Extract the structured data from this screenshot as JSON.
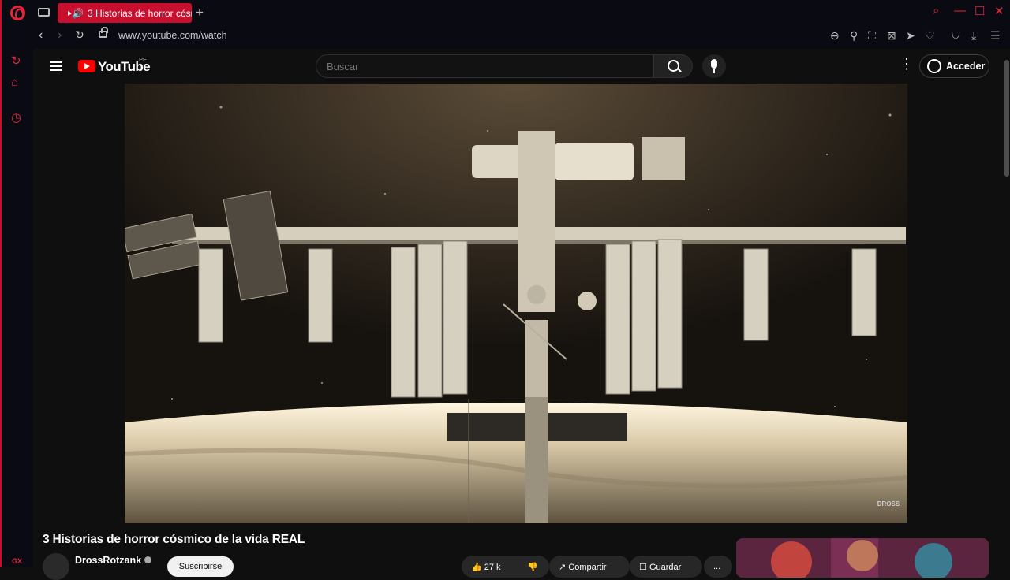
{
  "tab": {
    "title": "3 Historias de horror cósmico de la vida REAL"
  },
  "address": {
    "url": "www.youtube.com/watch"
  },
  "youtube": {
    "logo_text": "YouTube",
    "country": "PE",
    "search_placeholder": "Buscar",
    "signin_label": "Acceder"
  },
  "video": {
    "title": "3 Historias de horror cósmico de la vida REAL",
    "channel": "DrossRotzank",
    "subscribe_label": "Suscribirse",
    "likes": "27 k",
    "share_label": "Compartir",
    "save_label": "Guardar",
    "more_label": "...",
    "watermark": "DROSS"
  },
  "browser": {
    "sidebar_label": "GX"
  },
  "colors": {
    "accent": "#c8102e",
    "yt_red": "#ff0000",
    "bg": "#0f0f0f"
  }
}
